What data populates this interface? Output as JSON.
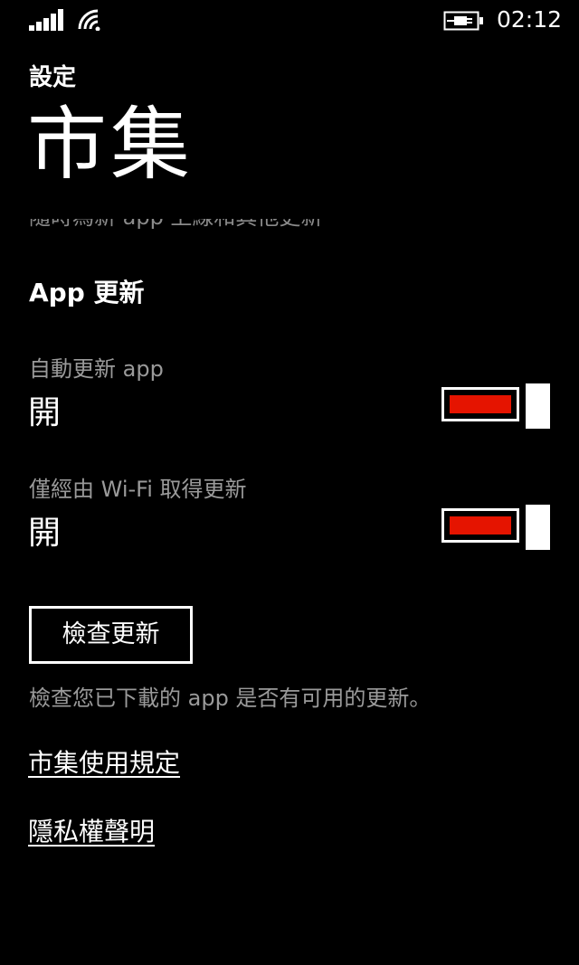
{
  "status_bar": {
    "time": "02:12",
    "icons": [
      "signal-icon",
      "wifi-icon",
      "battery-charging-icon"
    ]
  },
  "header": {
    "app_title": "設定",
    "page_title": "市集"
  },
  "partial_text": "隨時為新 app 上線和其他更新",
  "section": {
    "title": "App 更新"
  },
  "settings": [
    {
      "label": "自動更新 app",
      "value": "開",
      "toggle_on": true
    },
    {
      "label": "僅經由 Wi-Fi 取得更新",
      "value": "開",
      "toggle_on": true
    }
  ],
  "check_button": {
    "label": "檢查更新"
  },
  "check_hint": "檢查您已下載的 app 是否有可用的更新。",
  "links": [
    {
      "label": "市集使用規定"
    },
    {
      "label": "隱私權聲明"
    }
  ],
  "colors": {
    "background": "#000000",
    "foreground": "#ffffff",
    "accent": "#e51400",
    "secondary_text": "#9a9a9a"
  }
}
